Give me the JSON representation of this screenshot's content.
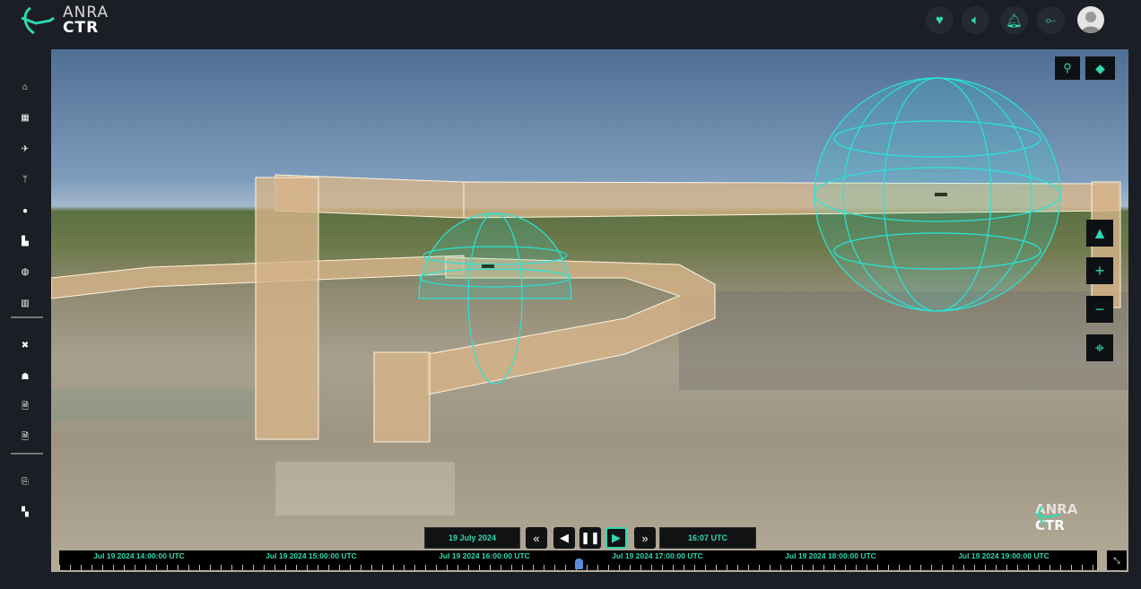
{
  "header": {
    "logo_line1": "ANRA",
    "logo_line2": "CTR",
    "icons": [
      "heartbeat-icon",
      "volume-icon",
      "bell-icon",
      "anra-drone-icon",
      "user-avatar"
    ]
  },
  "sidebar": {
    "items": [
      "home",
      "apps",
      "flight-landing",
      "tower",
      "circle",
      "factory",
      "globe",
      "map",
      "tools",
      "pilot",
      "search-document",
      "search-report",
      "exit",
      "dashboard"
    ]
  },
  "map": {
    "watermark_line1": "ANRA",
    "watermark_line2": "CTR",
    "colors": {
      "accent": "#2fd9b0",
      "volume": "#d7b48a",
      "sphere": "#25e6d8"
    }
  },
  "playback": {
    "date": "19 July 2024",
    "time": "16:07 UTC",
    "current_fraction": 0.5
  },
  "timeline": {
    "labels": [
      "Jul 19 2024 14:00:00 UTC",
      "Jul 19 2024 15:00:00 UTC",
      "Jul 19 2024 16:00:00 UTC",
      "Jul 19 2024 17:00:00 UTC",
      "Jul 19 2024 18:00:00 UTC",
      "Jul 19 2024 19:00:00 UTC"
    ]
  }
}
